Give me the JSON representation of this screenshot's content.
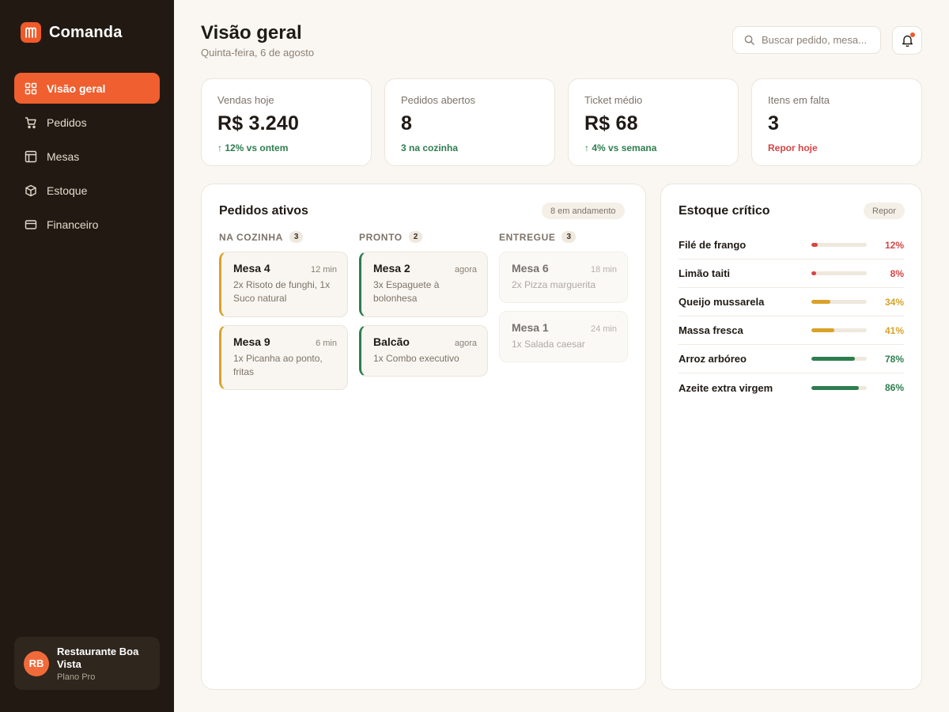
{
  "app": {
    "name": "Comanda"
  },
  "sidebar": {
    "items": [
      {
        "label": "Visão geral",
        "icon": "grid-icon",
        "active": true
      },
      {
        "label": "Pedidos",
        "icon": "cart-icon",
        "active": false
      },
      {
        "label": "Mesas",
        "icon": "layout-icon",
        "active": false
      },
      {
        "label": "Estoque",
        "icon": "box-icon",
        "active": false
      },
      {
        "label": "Financeiro",
        "icon": "card-icon",
        "active": false
      }
    ],
    "profile": {
      "initials": "RB",
      "name": "Restaurante Boa Vista",
      "plan": "Plano Pro"
    }
  },
  "header": {
    "title": "Visão geral",
    "date": "Quinta-feira, 6 de agosto",
    "search_placeholder": "Buscar pedido, mesa..."
  },
  "stats": [
    {
      "label": "Vendas hoje",
      "value": "R$ 3.240",
      "sub": "↑ 12% vs ontem",
      "tone": "green"
    },
    {
      "label": "Pedidos abertos",
      "value": "8",
      "sub": "3 na cozinha",
      "tone": "green"
    },
    {
      "label": "Ticket médio",
      "value": "R$ 68",
      "sub": "↑ 4% vs semana",
      "tone": "green"
    },
    {
      "label": "Itens em falta",
      "value": "3",
      "sub": "Repor hoje",
      "tone": "red"
    }
  ],
  "orders": {
    "title": "Pedidos ativos",
    "badge": "8 em andamento",
    "columns": [
      {
        "label": "NA COZINHA",
        "count": "3",
        "cards": [
          {
            "table": "Mesa 4",
            "time": "12 min",
            "items": "2x Risoto de funghi, 1x Suco natural"
          },
          {
            "table": "Mesa 9",
            "time": "6 min",
            "items": "1x Picanha ao ponto, fritas"
          }
        ]
      },
      {
        "label": "PRONTO",
        "count": "2",
        "cards": [
          {
            "table": "Mesa 2",
            "time": "agora",
            "items": "3x Espaguete à bolonhesa"
          },
          {
            "table": "Balcão",
            "time": "agora",
            "items": "1x Combo executivo"
          }
        ]
      },
      {
        "label": "ENTREGUE",
        "count": "3",
        "cards": [
          {
            "table": "Mesa 6",
            "time": "18 min",
            "items": "2x Pizza marguerita"
          },
          {
            "table": "Mesa 1",
            "time": "24 min",
            "items": "1x Salada caesar"
          }
        ]
      }
    ]
  },
  "stock": {
    "title": "Estoque crítico",
    "action": "Repor",
    "items": [
      {
        "name": "Filé de frango",
        "pct": "12%",
        "level": 0.12,
        "color": "#d64545"
      },
      {
        "name": "Limão taiti",
        "pct": "8%",
        "level": 0.08,
        "color": "#d64545"
      },
      {
        "name": "Queijo mussarela",
        "pct": "34%",
        "level": 0.34,
        "color": "#d9a22a"
      },
      {
        "name": "Massa fresca",
        "pct": "41%",
        "level": 0.41,
        "color": "#d9a22a"
      },
      {
        "name": "Arroz arbóreo",
        "pct": "78%",
        "level": 0.78,
        "color": "#2e7d4f"
      },
      {
        "name": "Azeite extra virgem",
        "pct": "86%",
        "level": 0.86,
        "color": "#2e7d4f"
      }
    ]
  }
}
